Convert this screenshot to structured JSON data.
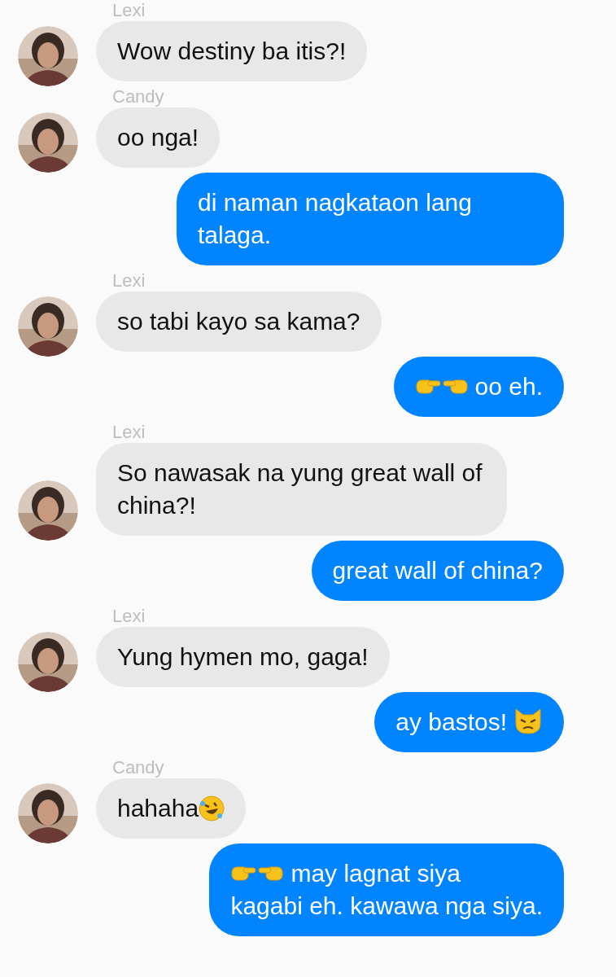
{
  "messages": [
    {
      "kind": "incoming",
      "sender": "Lexi",
      "parts": [
        {
          "kind": "text",
          "text": "Wow destiny ba itis?!"
        }
      ]
    },
    {
      "kind": "incoming",
      "sender": "Candy",
      "parts": [
        {
          "kind": "text",
          "text": "oo nga!"
        }
      ]
    },
    {
      "kind": "outgoing",
      "parts": [
        {
          "kind": "text",
          "text": "di naman nagkataon lang talaga."
        }
      ]
    },
    {
      "kind": "incoming",
      "sender": "Lexi",
      "parts": [
        {
          "kind": "text",
          "text": "so tabi kayo sa kama?"
        }
      ]
    },
    {
      "kind": "outgoing",
      "parts": [
        {
          "kind": "hands"
        },
        {
          "kind": "text",
          "text": "oo eh."
        }
      ]
    },
    {
      "kind": "incoming",
      "sender": "Lexi",
      "parts": [
        {
          "kind": "text",
          "text": "So nawasak na yung great wall of china?!"
        }
      ]
    },
    {
      "kind": "outgoing",
      "parts": [
        {
          "kind": "text",
          "text": "great wall of china?"
        }
      ]
    },
    {
      "kind": "incoming",
      "sender": "Lexi",
      "parts": [
        {
          "kind": "text",
          "text": "Yung hymen mo, gaga!"
        }
      ]
    },
    {
      "kind": "outgoing",
      "parts": [
        {
          "kind": "text",
          "text": "ay bastos!"
        },
        {
          "kind": "cat"
        }
      ]
    },
    {
      "kind": "incoming",
      "sender": "Candy",
      "parts": [
        {
          "kind": "text",
          "text": "hahaha"
        },
        {
          "kind": "laugh"
        }
      ]
    },
    {
      "kind": "outgoing",
      "parts": [
        {
          "kind": "hands"
        },
        {
          "kind": "text",
          "text": "may lagnat siya"
        },
        {
          "kind": "break"
        },
        {
          "kind": "text",
          "text": "kagabi eh. kawawa nga siya."
        }
      ]
    }
  ]
}
